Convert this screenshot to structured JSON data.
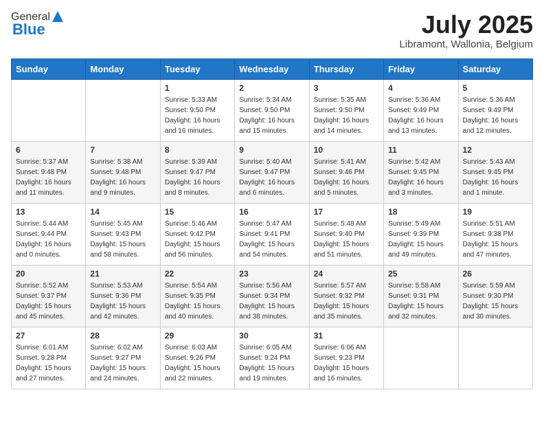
{
  "logo": {
    "general": "General",
    "blue": "Blue"
  },
  "title": {
    "month_year": "July 2025",
    "location": "Libramont, Wallonia, Belgium"
  },
  "headers": [
    "Sunday",
    "Monday",
    "Tuesday",
    "Wednesday",
    "Thursday",
    "Friday",
    "Saturday"
  ],
  "weeks": [
    [
      {
        "day": "",
        "info": ""
      },
      {
        "day": "",
        "info": ""
      },
      {
        "day": "1",
        "info": "Sunrise: 5:33 AM\nSunset: 9:50 PM\nDaylight: 16 hours and 16 minutes."
      },
      {
        "day": "2",
        "info": "Sunrise: 5:34 AM\nSunset: 9:50 PM\nDaylight: 16 hours and 15 minutes."
      },
      {
        "day": "3",
        "info": "Sunrise: 5:35 AM\nSunset: 9:50 PM\nDaylight: 16 hours and 14 minutes."
      },
      {
        "day": "4",
        "info": "Sunrise: 5:36 AM\nSunset: 9:49 PM\nDaylight: 16 hours and 13 minutes."
      },
      {
        "day": "5",
        "info": "Sunrise: 5:36 AM\nSunset: 9:49 PM\nDaylight: 16 hours and 12 minutes."
      }
    ],
    [
      {
        "day": "6",
        "info": "Sunrise: 5:37 AM\nSunset: 9:48 PM\nDaylight: 16 hours and 11 minutes."
      },
      {
        "day": "7",
        "info": "Sunrise: 5:38 AM\nSunset: 9:48 PM\nDaylight: 16 hours and 9 minutes."
      },
      {
        "day": "8",
        "info": "Sunrise: 5:39 AM\nSunset: 9:47 PM\nDaylight: 16 hours and 8 minutes."
      },
      {
        "day": "9",
        "info": "Sunrise: 5:40 AM\nSunset: 9:47 PM\nDaylight: 16 hours and 6 minutes."
      },
      {
        "day": "10",
        "info": "Sunrise: 5:41 AM\nSunset: 9:46 PM\nDaylight: 16 hours and 5 minutes."
      },
      {
        "day": "11",
        "info": "Sunrise: 5:42 AM\nSunset: 9:45 PM\nDaylight: 16 hours and 3 minutes."
      },
      {
        "day": "12",
        "info": "Sunrise: 5:43 AM\nSunset: 9:45 PM\nDaylight: 16 hours and 1 minute."
      }
    ],
    [
      {
        "day": "13",
        "info": "Sunrise: 5:44 AM\nSunset: 9:44 PM\nDaylight: 16 hours and 0 minutes."
      },
      {
        "day": "14",
        "info": "Sunrise: 5:45 AM\nSunset: 9:43 PM\nDaylight: 15 hours and 58 minutes."
      },
      {
        "day": "15",
        "info": "Sunrise: 5:46 AM\nSunset: 9:42 PM\nDaylight: 15 hours and 56 minutes."
      },
      {
        "day": "16",
        "info": "Sunrise: 5:47 AM\nSunset: 9:41 PM\nDaylight: 15 hours and 54 minutes."
      },
      {
        "day": "17",
        "info": "Sunrise: 5:48 AM\nSunset: 9:40 PM\nDaylight: 15 hours and 51 minutes."
      },
      {
        "day": "18",
        "info": "Sunrise: 5:49 AM\nSunset: 9:39 PM\nDaylight: 15 hours and 49 minutes."
      },
      {
        "day": "19",
        "info": "Sunrise: 5:51 AM\nSunset: 9:38 PM\nDaylight: 15 hours and 47 minutes."
      }
    ],
    [
      {
        "day": "20",
        "info": "Sunrise: 5:52 AM\nSunset: 9:37 PM\nDaylight: 15 hours and 45 minutes."
      },
      {
        "day": "21",
        "info": "Sunrise: 5:53 AM\nSunset: 9:36 PM\nDaylight: 15 hours and 42 minutes."
      },
      {
        "day": "22",
        "info": "Sunrise: 5:54 AM\nSunset: 9:35 PM\nDaylight: 15 hours and 40 minutes."
      },
      {
        "day": "23",
        "info": "Sunrise: 5:56 AM\nSunset: 9:34 PM\nDaylight: 15 hours and 38 minutes."
      },
      {
        "day": "24",
        "info": "Sunrise: 5:57 AM\nSunset: 9:32 PM\nDaylight: 15 hours and 35 minutes."
      },
      {
        "day": "25",
        "info": "Sunrise: 5:58 AM\nSunset: 9:31 PM\nDaylight: 15 hours and 32 minutes."
      },
      {
        "day": "26",
        "info": "Sunrise: 5:59 AM\nSunset: 9:30 PM\nDaylight: 15 hours and 30 minutes."
      }
    ],
    [
      {
        "day": "27",
        "info": "Sunrise: 6:01 AM\nSunset: 9:28 PM\nDaylight: 15 hours and 27 minutes."
      },
      {
        "day": "28",
        "info": "Sunrise: 6:02 AM\nSunset: 9:27 PM\nDaylight: 15 hours and 24 minutes."
      },
      {
        "day": "29",
        "info": "Sunrise: 6:03 AM\nSunset: 9:26 PM\nDaylight: 15 hours and 22 minutes."
      },
      {
        "day": "30",
        "info": "Sunrise: 6:05 AM\nSunset: 9:24 PM\nDaylight: 15 hours and 19 minutes."
      },
      {
        "day": "31",
        "info": "Sunrise: 6:06 AM\nSunset: 9:23 PM\nDaylight: 15 hours and 16 minutes."
      },
      {
        "day": "",
        "info": ""
      },
      {
        "day": "",
        "info": ""
      }
    ]
  ]
}
